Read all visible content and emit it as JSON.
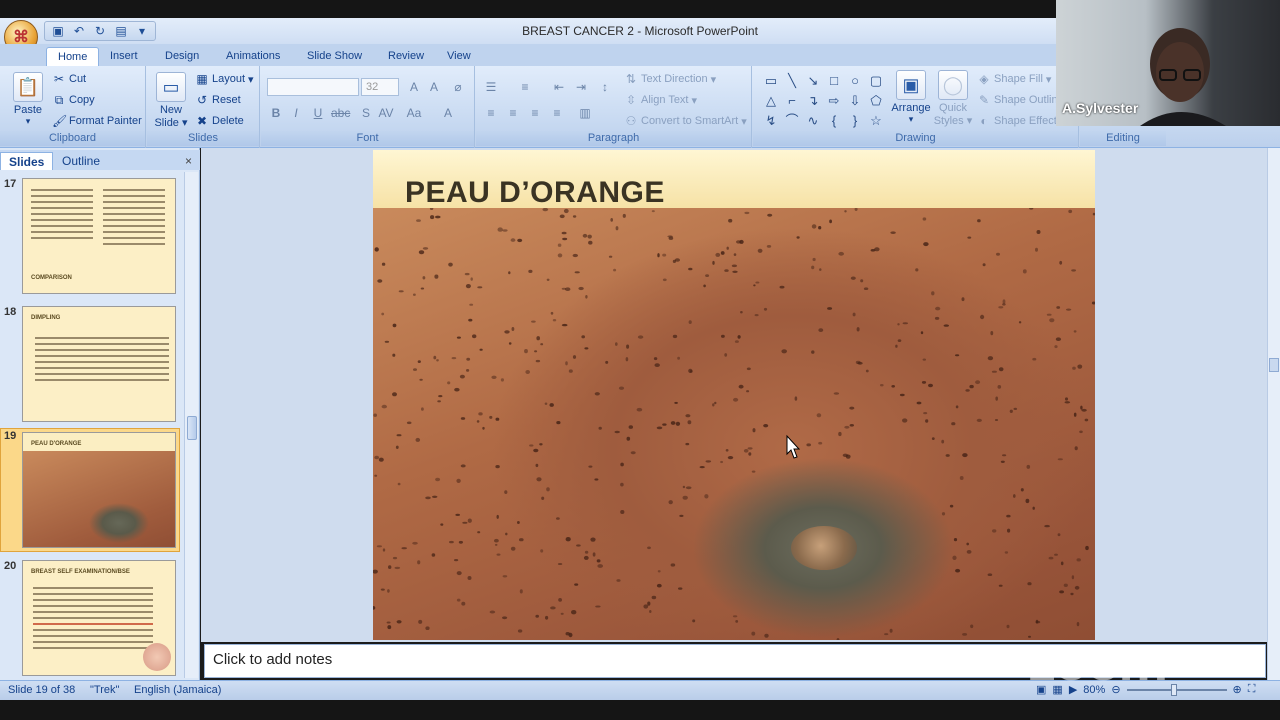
{
  "app": {
    "title": "BREAST CANCER 2 - Microsoft PowerPoint",
    "office_logo": "office-button"
  },
  "quick_access": [
    "save-icon",
    "undo-icon",
    "redo-icon",
    "customize-icon"
  ],
  "tabs": [
    {
      "label": "Home",
      "active": true
    },
    {
      "label": "Insert"
    },
    {
      "label": "Design"
    },
    {
      "label": "Animations"
    },
    {
      "label": "Slide Show"
    },
    {
      "label": "Review"
    },
    {
      "label": "View"
    }
  ],
  "ribbon": {
    "clipboard": {
      "label": "Clipboard",
      "paste": "Paste",
      "cut": "Cut",
      "copy": "Copy",
      "format_painter": "Format Painter"
    },
    "slides": {
      "label": "Slides",
      "new_slide_1": "New",
      "new_slide_2": "Slide",
      "layout": "Layout",
      "reset": "Reset",
      "delete": "Delete"
    },
    "font": {
      "label": "Font",
      "font_name": "",
      "font_size": "32"
    },
    "paragraph": {
      "label": "Paragraph",
      "text_direction": "Text Direction",
      "align_text": "Align Text",
      "convert_smartart": "Convert to SmartArt"
    },
    "drawing": {
      "label": "Drawing",
      "arrange": "Arrange",
      "quick_styles_1": "Quick",
      "quick_styles_2": "Styles",
      "shape_fill": "Shape Fill",
      "shape_outline": "Shape Outline",
      "shape_effects": "Shape Effects"
    },
    "editing": {
      "label": "Editing"
    }
  },
  "panel": {
    "tab_slides": "Slides",
    "tab_outline": "Outline",
    "close": "×",
    "thumbnails": [
      {
        "num": "17",
        "title": "COMPARISON"
      },
      {
        "num": "18",
        "title": "DIMPLING"
      },
      {
        "num": "19",
        "title": "PEAU D'ORANGE",
        "selected": true
      },
      {
        "num": "20",
        "title": "BREAST SELF EXAMINATION/BSE"
      }
    ]
  },
  "slide": {
    "title": "PEAU D’ORANGE"
  },
  "notes": {
    "placeholder": "Click to add notes"
  },
  "status": {
    "slide_info": "Slide 19 of 38",
    "theme": "\"Trek\"",
    "language": "English (Jamaica)",
    "zoom": "80%"
  },
  "webcam": {
    "name": "A.Sylvester"
  },
  "watermark": "zoom"
}
